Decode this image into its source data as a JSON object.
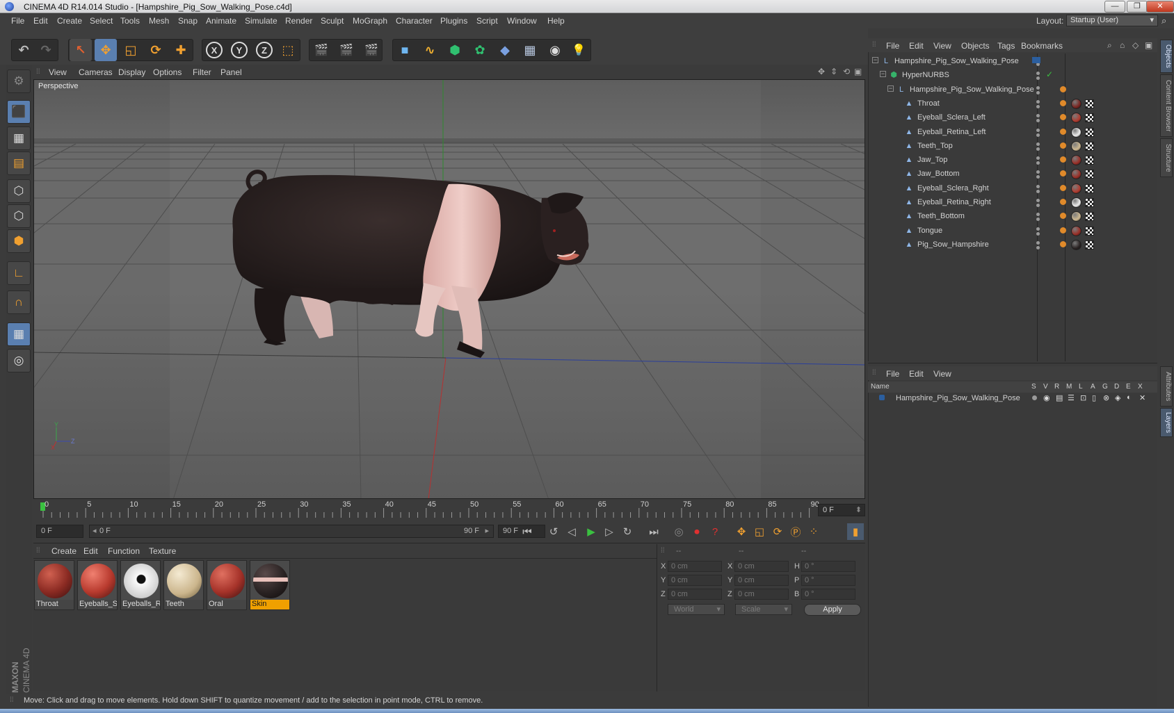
{
  "window": {
    "title": "CINEMA 4D R14.014 Studio - [Hampshire_Pig_Sow_Walking_Pose.c4d]",
    "min": "—",
    "restore": "❐",
    "close": "✕"
  },
  "menubar": {
    "items": [
      "File",
      "Edit",
      "Create",
      "Select",
      "Tools",
      "Mesh",
      "Snap",
      "Animate",
      "Simulate",
      "Render",
      "Sculpt",
      "MoGraph",
      "Character",
      "Plugins",
      "Script",
      "Window",
      "Help"
    ],
    "layout_label": "Layout:",
    "layout_value": "Startup (User)"
  },
  "toolbar": {
    "buttons": [
      {
        "name": "undo-icon",
        "glyph": "↶"
      },
      {
        "name": "redo-icon",
        "glyph": "↷"
      },
      {
        "name": "live-selection-icon",
        "glyph": "↖"
      },
      {
        "name": "move-icon",
        "glyph": "✥"
      },
      {
        "name": "scale-icon",
        "glyph": "◱"
      },
      {
        "name": "rotate-icon",
        "glyph": "⟳"
      },
      {
        "name": "move-world-icon",
        "glyph": "✚"
      },
      {
        "name": "x-axis-lock-icon",
        "glyph": "X"
      },
      {
        "name": "y-axis-lock-icon",
        "glyph": "Y"
      },
      {
        "name": "z-axis-lock-icon",
        "glyph": "Z"
      },
      {
        "name": "coordinate-system-icon",
        "glyph": "⬚"
      },
      {
        "name": "render-view-icon",
        "glyph": "🎬"
      },
      {
        "name": "render-picture-viewer-icon",
        "glyph": "🎬"
      },
      {
        "name": "render-settings-icon",
        "glyph": "🎬"
      },
      {
        "name": "cube-icon",
        "glyph": "■"
      },
      {
        "name": "spline-icon",
        "glyph": "∿"
      },
      {
        "name": "nurbs-icon",
        "glyph": "⬢"
      },
      {
        "name": "array-icon",
        "glyph": "✿"
      },
      {
        "name": "deformer-icon",
        "glyph": "◆"
      },
      {
        "name": "floor-icon",
        "glyph": "▦"
      },
      {
        "name": "camera-icon",
        "glyph": "◉"
      },
      {
        "name": "light-icon",
        "glyph": "💡"
      }
    ]
  },
  "viewport": {
    "menu": [
      "View",
      "Cameras",
      "Display",
      "Options",
      "Filter",
      "Panel"
    ],
    "label": "Perspective",
    "axis": {
      "x": "X",
      "y": "Y",
      "z": "Z"
    }
  },
  "timeline": {
    "ticks": [
      "0",
      "5",
      "10",
      "15",
      "20",
      "25",
      "30",
      "35",
      "40",
      "45",
      "50",
      "55",
      "60",
      "65",
      "70",
      "75",
      "80",
      "85",
      "90"
    ],
    "current_frame": "0 F"
  },
  "transport": {
    "start_field": "0 F",
    "slider_start": "0 F",
    "slider_end": "90 F",
    "end_field": "90 F"
  },
  "materials": {
    "menu": [
      "Create",
      "Edit",
      "Function",
      "Texture"
    ],
    "items": [
      {
        "label": "Throat",
        "color": "#8a2a22"
      },
      {
        "label": "Eyeballs_Sc",
        "color": "#b83a2e"
      },
      {
        "label": "Eyeballs_Re",
        "color": "#f2f2f2"
      },
      {
        "label": "Teeth",
        "color": "#d8c9a8"
      },
      {
        "label": "Oral",
        "color": "#a53229"
      },
      {
        "label": "Skin",
        "color": "#2a2323"
      }
    ]
  },
  "coords": {
    "headers": [
      "--",
      "--",
      "--"
    ],
    "rows": [
      {
        "a": "X",
        "av": "0 cm",
        "b": "X",
        "bv": "0 cm",
        "c": "H",
        "cv": "0 °"
      },
      {
        "a": "Y",
        "av": "0 cm",
        "b": "Y",
        "bv": "0 cm",
        "c": "P",
        "cv": "0 °"
      },
      {
        "a": "Z",
        "av": "0 cm",
        "b": "Z",
        "bv": "0 cm",
        "c": "B",
        "cv": "0 °"
      }
    ],
    "space": "World",
    "mode": "Scale",
    "apply": "Apply"
  },
  "objects": {
    "menu": [
      "File",
      "Edit",
      "View",
      "Objects",
      "Tags",
      "Bookmarks"
    ],
    "rows": [
      {
        "name": "Hampshire_Pig_Sow_Walking_Pose",
        "indent": 0,
        "icon": "null-icon"
      },
      {
        "name": "HyperNURBS",
        "indent": 1,
        "icon": "hypernurbs-icon"
      },
      {
        "name": "Hampshire_Pig_Sow_Walking_Pose",
        "indent": 2,
        "icon": "null-icon"
      },
      {
        "name": "Throat",
        "indent": 3,
        "icon": "polygon-icon",
        "ball": "#7a2420"
      },
      {
        "name": "Eyeball_Sclera_Left",
        "indent": 3,
        "icon": "polygon-icon",
        "ball": "#b03a2e"
      },
      {
        "name": "Eyeball_Retina_Left",
        "indent": 3,
        "icon": "polygon-icon",
        "ball": "#eeeeee"
      },
      {
        "name": "Teeth_Top",
        "indent": 3,
        "icon": "polygon-icon",
        "ball": "#cdb890"
      },
      {
        "name": "Jaw_Top",
        "indent": 3,
        "icon": "polygon-icon",
        "ball": "#9a2e26"
      },
      {
        "name": "Jaw_Bottom",
        "indent": 3,
        "icon": "polygon-icon",
        "ball": "#9a2e26"
      },
      {
        "name": "Eyeball_Sclera_Rght",
        "indent": 3,
        "icon": "polygon-icon",
        "ball": "#b03a2e"
      },
      {
        "name": "Eyeball_Retina_Right",
        "indent": 3,
        "icon": "polygon-icon",
        "ball": "#eeeeee"
      },
      {
        "name": "Teeth_Bottom",
        "indent": 3,
        "icon": "polygon-icon",
        "ball": "#cdb890"
      },
      {
        "name": "Tongue",
        "indent": 3,
        "icon": "polygon-icon",
        "ball": "#9a2e26"
      },
      {
        "name": "Pig_Sow_Hampshire",
        "indent": 3,
        "icon": "polygon-icon",
        "ball": "#2a2323"
      }
    ]
  },
  "layers": {
    "menu": [
      "File",
      "Edit",
      "View"
    ],
    "headers": [
      "Name",
      "S",
      "V",
      "R",
      "M",
      "L",
      "A",
      "G",
      "D",
      "E",
      "X"
    ],
    "row": "Hampshire_Pig_Sow_Walking_Pose"
  },
  "sidetabs": [
    "Objects",
    "Content Browser",
    "Structure",
    "Attributes",
    "Layers"
  ],
  "status": "Move: Click and drag to move elements. Hold down SHIFT to quantize movement / add to the selection in point mode, CTRL to remove.",
  "brand": {
    "line1": "MAXON",
    "line2": "CINEMA 4D"
  },
  "colors": {
    "accent": "#5a7fb0",
    "selection": "#f0a000"
  }
}
